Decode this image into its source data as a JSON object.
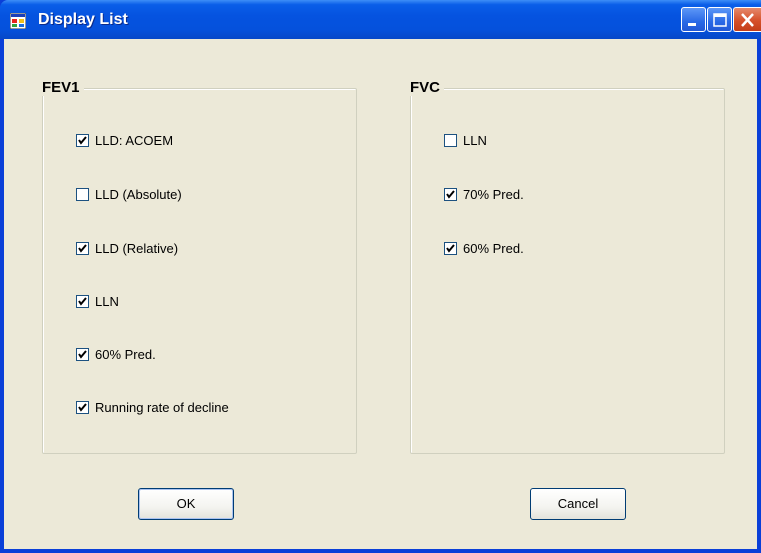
{
  "window": {
    "title": "Display List",
    "colors": {
      "titlebar": "#0553e0",
      "client": "#ece9d8",
      "close_button": "#d6502a"
    }
  },
  "icons": {
    "app": "app-window-icon",
    "minimize": "minimize-icon",
    "maximize": "maximize-icon",
    "close": "close-icon",
    "checkmark": "checkmark-icon"
  },
  "fev1": {
    "title": "FEV1",
    "options": [
      {
        "label": "LLD: ACOEM",
        "checked": true
      },
      {
        "label": "LLD (Absolute)",
        "checked": false
      },
      {
        "label": "LLD (Relative)",
        "checked": true
      },
      {
        "label": "LLN",
        "checked": true
      },
      {
        "label": "60% Pred.",
        "checked": true
      },
      {
        "label": "Running rate of decline",
        "checked": true
      }
    ]
  },
  "fvc": {
    "title": "FVC",
    "options": [
      {
        "label": "LLN",
        "checked": false
      },
      {
        "label": "70% Pred.",
        "checked": true
      },
      {
        "label": "60% Pred.",
        "checked": true
      }
    ]
  },
  "buttons": {
    "ok": "OK",
    "cancel": "Cancel"
  }
}
